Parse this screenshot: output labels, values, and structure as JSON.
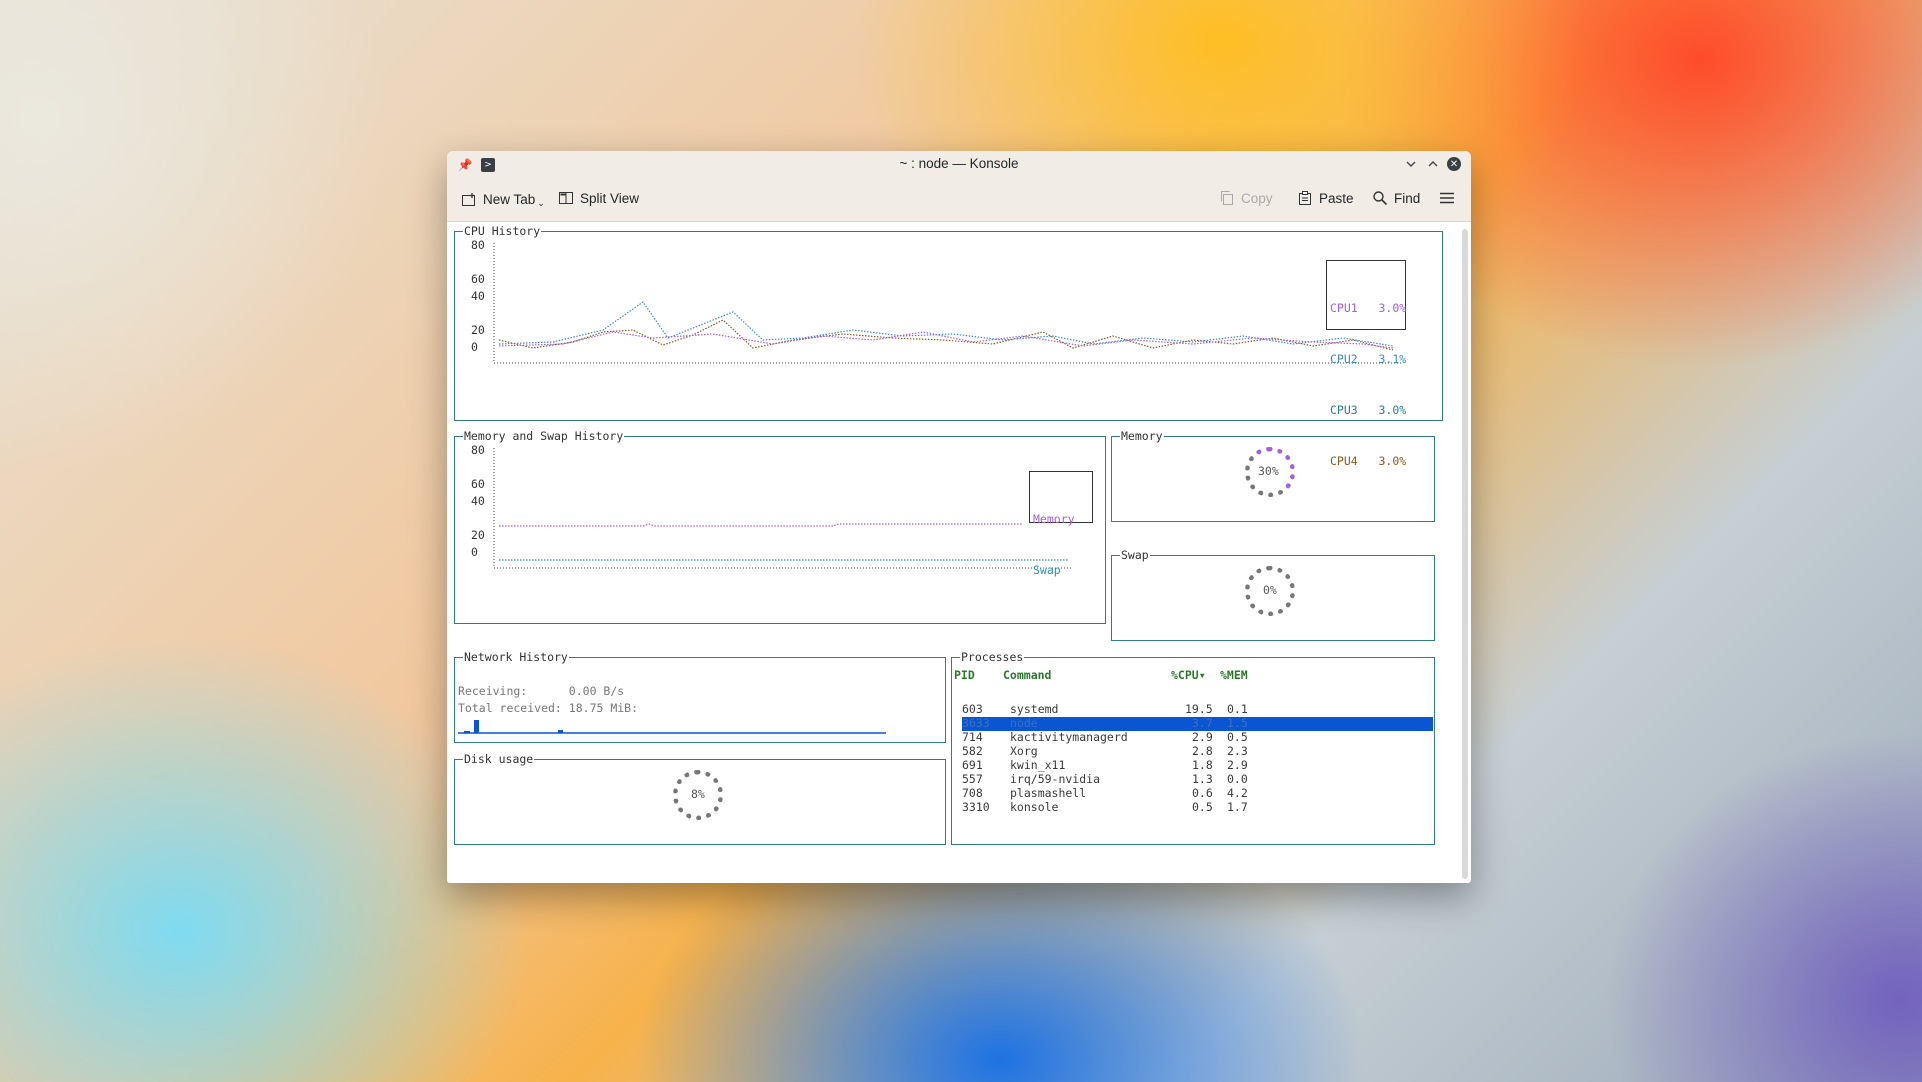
{
  "window": {
    "title": "~ : node — Konsole",
    "accent": "#0a55d1"
  },
  "toolbar": {
    "new_tab": "New Tab",
    "split_view": "Split View",
    "copy": "Copy",
    "paste": "Paste",
    "find": "Find"
  },
  "cpu": {
    "title": "CPU History",
    "yticks": [
      "80",
      "60",
      "40",
      "20",
      "0"
    ],
    "legend": [
      {
        "name": "CPU1",
        "value": "3.0%",
        "color": "#a45ee5"
      },
      {
        "name": "CPU2",
        "value": "3.1%",
        "color": "#3a8bd6"
      },
      {
        "name": "CPU3",
        "value": "3.0%",
        "color": "#2b7f9e"
      },
      {
        "name": "CPU4",
        "value": "3.0%",
        "color": "#8a5a1e"
      }
    ]
  },
  "memswap": {
    "title": "Memory and Swap History",
    "yticks": [
      "80",
      "60",
      "40",
      "20",
      "0"
    ],
    "legend": [
      {
        "name": "Memory",
        "color": "#a45ee5"
      },
      {
        "name": "Swap",
        "color": "#2b8fa7"
      }
    ]
  },
  "memory": {
    "title": "Memory",
    "value": "30%"
  },
  "swap": {
    "title": "Swap",
    "value": "0%"
  },
  "network": {
    "title": "Network History",
    "receiving_label": "Receiving:",
    "receiving_value": "0.00 B/s",
    "total_label": "Total received:",
    "total_value": "18.75 MiB:"
  },
  "disk": {
    "title": "Disk usage",
    "value": "8%"
  },
  "processes": {
    "title": "Processes",
    "headers": {
      "pid": "PID",
      "command": "Command",
      "cpu": "%CPU▾",
      "mem": "%MEM"
    },
    "rows": [
      {
        "pid": "603",
        "command": "systemd",
        "cpu": "19.5",
        "mem": "0.1"
      },
      {
        "pid": "3633",
        "command": "node",
        "cpu": "3.7",
        "mem": "1.5",
        "selected": true
      },
      {
        "pid": "714",
        "command": "kactivitymanagerd",
        "cpu": "2.9",
        "mem": "0.5"
      },
      {
        "pid": "582",
        "command": "Xorg",
        "cpu": "2.8",
        "mem": "2.3"
      },
      {
        "pid": "691",
        "command": "kwin_x11",
        "cpu": "1.8",
        "mem": "2.9"
      },
      {
        "pid": "557",
        "command": "irq/59-nvidia",
        "cpu": "1.3",
        "mem": "0.0"
      },
      {
        "pid": "708",
        "command": "plasmashell",
        "cpu": "0.6",
        "mem": "4.2"
      },
      {
        "pid": "3310",
        "command": "konsole",
        "cpu": "0.5",
        "mem": "1.7"
      }
    ]
  }
}
